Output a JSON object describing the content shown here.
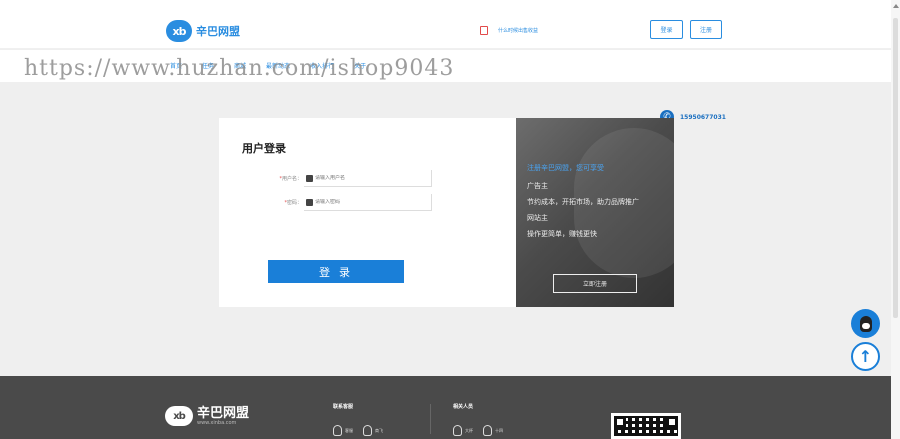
{
  "header": {
    "logo_mark": "xb",
    "logo_text": "辛巴网盟",
    "notice": "什么时候出售收益",
    "login_label": "登录",
    "register_label": "注册"
  },
  "nav": {
    "items": [
      "首页",
      "任务",
      "商城",
      "最新动态",
      "收入排行",
      "关于"
    ],
    "phone": "15950677031"
  },
  "watermark": "https://www.huzhan.com/ishop9043",
  "login": {
    "title": "用户登录",
    "username_label": "用户名：",
    "username_placeholder": "请输入用户名",
    "password_label": "密码：",
    "password_placeholder": "请输入密码",
    "required_mark": "*",
    "submit_label": "登 录"
  },
  "promo": {
    "heading": "注册辛巴网盟，您可享受",
    "lines": [
      "广告主",
      "节约成本，开拓市场，助力品牌推广",
      "网站主",
      "操作更简单，赚钱更快"
    ],
    "register_label": "立即注册"
  },
  "floating": {
    "top_arrow": "↑"
  },
  "footer": {
    "logo_mark": "xb",
    "brand_name": "辛巴网盟",
    "brand_domain": "www.xinba.com",
    "service": {
      "title": "联系客服",
      "items": [
        "客服",
        "商飞"
      ]
    },
    "staff": {
      "title": "相关人员",
      "items": [
        "大杯",
        "十四"
      ]
    }
  },
  "colors": {
    "brand_blue": "#2a8de0",
    "button_blue": "#1a7fd8",
    "footer_bg": "#4a4a4a",
    "page_bg": "#efefef"
  }
}
